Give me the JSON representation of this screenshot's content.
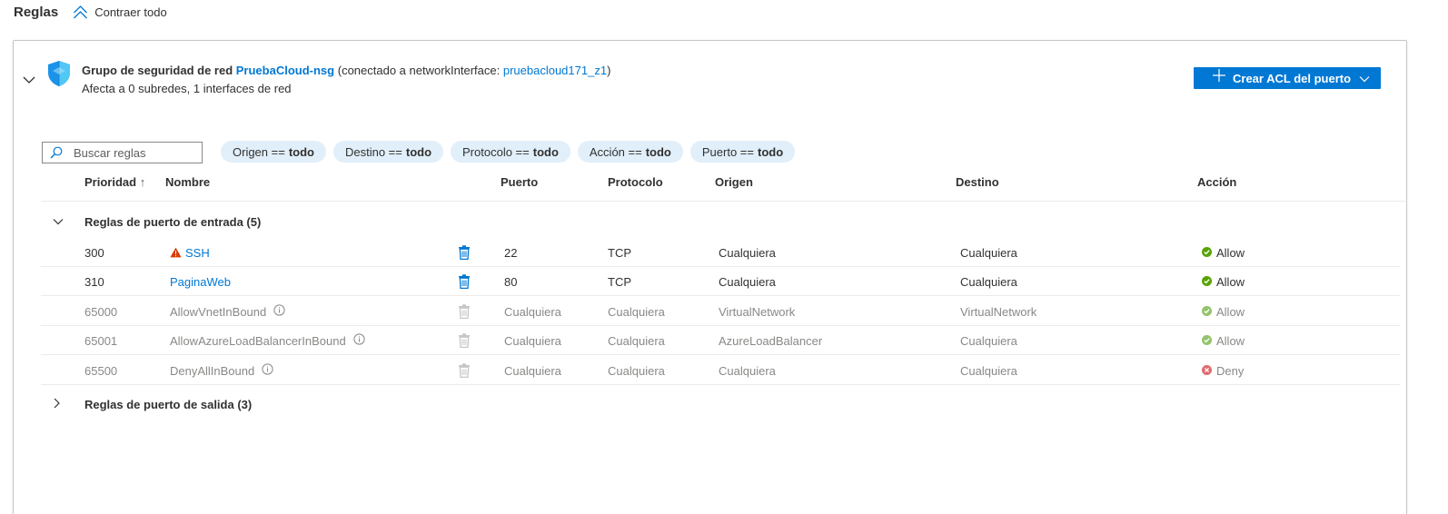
{
  "header": {
    "title": "Reglas",
    "collapse_all": "Contraer todo"
  },
  "nsg": {
    "prefix": "Grupo de seguridad de red",
    "name": "PruebaCloud-nsg",
    "attached_prefix": "(conectado a networkInterface:",
    "interface": "pruebacloud171_z1",
    "attached_suffix": ")",
    "subtitle": "Afecta a 0 subredes, 1 interfaces de red",
    "create_button": "Crear ACL del puerto"
  },
  "search": {
    "placeholder": "Buscar reglas"
  },
  "filters": [
    {
      "key": "Origen ==",
      "value": "todo"
    },
    {
      "key": "Destino ==",
      "value": "todo"
    },
    {
      "key": "Protocolo ==",
      "value": "todo"
    },
    {
      "key": "Acción ==",
      "value": "todo"
    },
    {
      "key": "Puerto ==",
      "value": "todo"
    }
  ],
  "columns": {
    "priority": "Prioridad",
    "sort_indicator": "↑",
    "name": "Nombre",
    "port": "Puerto",
    "protocol": "Protocolo",
    "source": "Origen",
    "destination": "Destino",
    "action": "Acción"
  },
  "inbound": {
    "label": "Reglas de puerto de entrada (5)",
    "rules": [
      {
        "priority": "300",
        "name": "SSH",
        "warning": true,
        "link": true,
        "default": false,
        "port": "22",
        "protocol": "TCP",
        "source": "Cualquiera",
        "destination": "Cualquiera",
        "action": "Allow"
      },
      {
        "priority": "310",
        "name": "PaginaWeb",
        "warning": false,
        "link": true,
        "default": false,
        "port": "80",
        "protocol": "TCP",
        "source": "Cualquiera",
        "destination": "Cualquiera",
        "action": "Allow"
      },
      {
        "priority": "65000",
        "name": "AllowVnetInBound",
        "warning": false,
        "link": false,
        "default": true,
        "port": "Cualquiera",
        "protocol": "Cualquiera",
        "source": "VirtualNetwork",
        "destination": "VirtualNetwork",
        "action": "Allow"
      },
      {
        "priority": "65001",
        "name": "AllowAzureLoadBalancerInBound",
        "warning": false,
        "link": false,
        "default": true,
        "port": "Cualquiera",
        "protocol": "Cualquiera",
        "source": "AzureLoadBalancer",
        "destination": "Cualquiera",
        "action": "Allow"
      },
      {
        "priority": "65500",
        "name": "DenyAllInBound",
        "warning": false,
        "link": false,
        "default": true,
        "port": "Cualquiera",
        "protocol": "Cualquiera",
        "source": "Cualquiera",
        "destination": "Cualquiera",
        "action": "Deny"
      }
    ]
  },
  "outbound": {
    "label": "Reglas de puerto de salida (3)"
  },
  "colors": {
    "accent": "#0078d4",
    "allow": "#57a300",
    "allow_muted": "#93c36b",
    "deny": "#e06b70",
    "warning": "#d83b01",
    "pill_bg": "#e1effa"
  }
}
